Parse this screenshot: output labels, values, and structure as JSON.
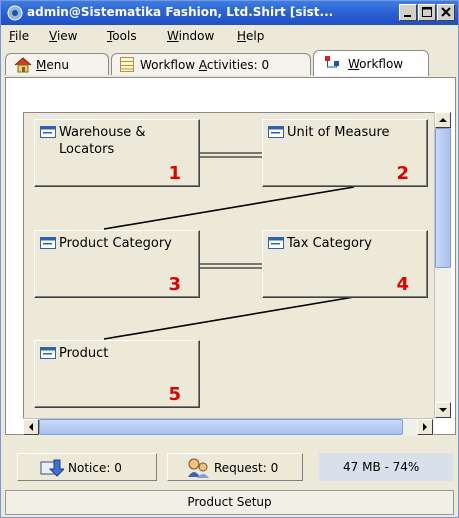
{
  "window": {
    "title": "admin@Sistematika Fashion, Ltd.Shirt [sist..."
  },
  "menubar": {
    "items": [
      {
        "underline": "F",
        "rest": "ile"
      },
      {
        "underline": "V",
        "rest": "iew"
      },
      {
        "underline": "T",
        "rest": "ools"
      },
      {
        "underline": "W",
        "rest": "indow"
      },
      {
        "underline": "H",
        "rest": "elp"
      }
    ]
  },
  "tabs": [
    {
      "underline": "M",
      "rest": "enu",
      "icon": "home-icon"
    },
    {
      "pre": "Workflow ",
      "underline": "A",
      "rest": "ctivities: 0",
      "icon": "activities-icon"
    },
    {
      "underline": "W",
      "rest": "orkflow",
      "icon": "workflow-icon",
      "active": true
    }
  ],
  "workflow": {
    "nodes": [
      {
        "label": "Warehouse & Locators",
        "number": "1"
      },
      {
        "label": "Unit of Measure",
        "number": "2"
      },
      {
        "label": "Product Category",
        "number": "3"
      },
      {
        "label": "Tax Category",
        "number": "4"
      },
      {
        "label": "Product",
        "number": "5"
      }
    ]
  },
  "status": {
    "notice": "Notice: 0",
    "request": "Request: 0",
    "memory": "47 MB - 74%"
  },
  "footer": {
    "label": "Product Setup"
  },
  "colors": {
    "number_red": "#e00000",
    "title_blue": "#2b62d4"
  }
}
